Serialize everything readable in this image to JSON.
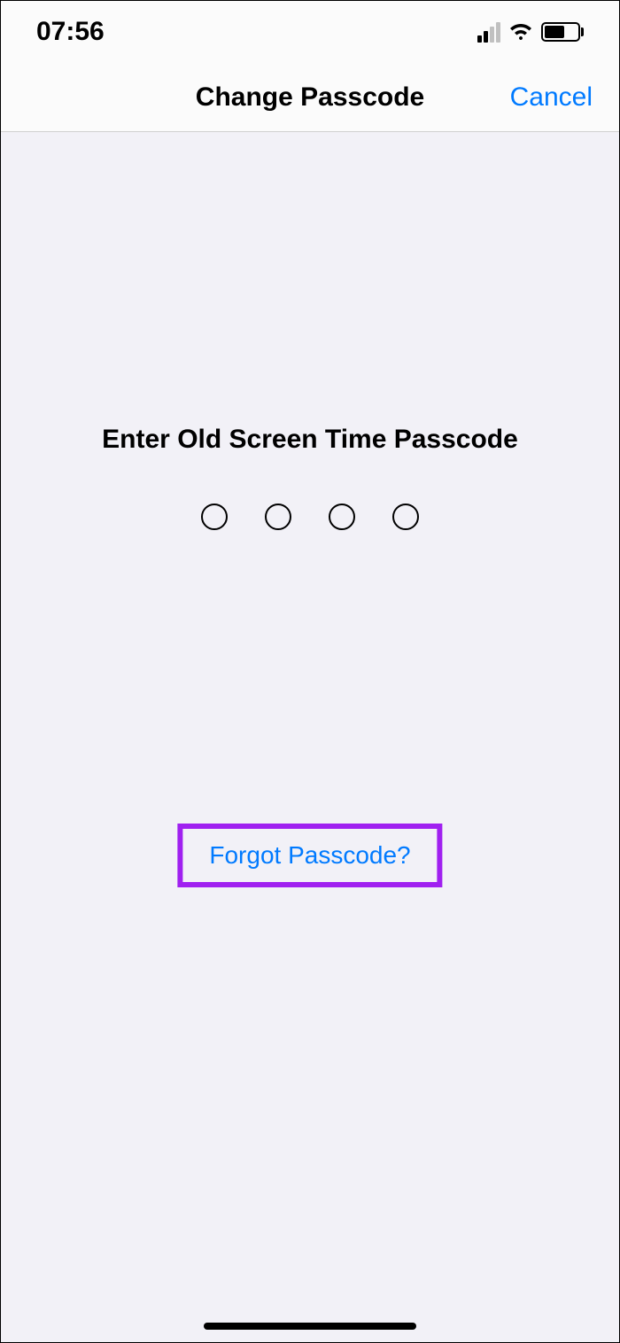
{
  "status_bar": {
    "time": "07:56"
  },
  "nav": {
    "title": "Change Passcode",
    "cancel": "Cancel"
  },
  "content": {
    "prompt": "Enter Old Screen Time Passcode",
    "forgot": "Forgot Passcode?"
  }
}
